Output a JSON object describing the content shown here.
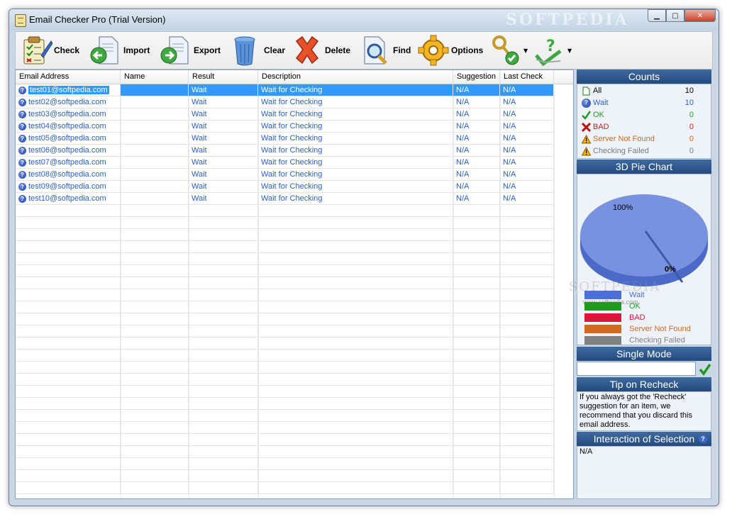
{
  "window": {
    "title": "Email Checker Pro (Trial Version)",
    "watermark": "SOFTPEDIA"
  },
  "toolbar": {
    "items": [
      {
        "label": "Check"
      },
      {
        "label": "Import"
      },
      {
        "label": "Export"
      },
      {
        "label": "Clear"
      },
      {
        "label": "Delete"
      },
      {
        "label": "Find"
      },
      {
        "label": "Options"
      }
    ]
  },
  "grid": {
    "columns": [
      "Email Address",
      "Name",
      "Result",
      "Description",
      "Suggestion",
      "Last Check"
    ],
    "rows": [
      {
        "email": "test01@softpedia.com",
        "name": "",
        "result": "Wait",
        "description": "Wait for Checking",
        "suggestion": "N/A",
        "last_check": "N/A"
      },
      {
        "email": "test02@softpedia.com",
        "name": "",
        "result": "Wait",
        "description": "Wait for Checking",
        "suggestion": "N/A",
        "last_check": "N/A"
      },
      {
        "email": "test03@softpedia.com",
        "name": "",
        "result": "Wait",
        "description": "Wait for Checking",
        "suggestion": "N/A",
        "last_check": "N/A"
      },
      {
        "email": "test04@softpedia.com",
        "name": "",
        "result": "Wait",
        "description": "Wait for Checking",
        "suggestion": "N/A",
        "last_check": "N/A"
      },
      {
        "email": "test05@softpedia.com",
        "name": "",
        "result": "Wait",
        "description": "Wait for Checking",
        "suggestion": "N/A",
        "last_check": "N/A"
      },
      {
        "email": "test06@softpedia.com",
        "name": "",
        "result": "Wait",
        "description": "Wait for Checking",
        "suggestion": "N/A",
        "last_check": "N/A"
      },
      {
        "email": "test07@softpedia.com",
        "name": "",
        "result": "Wait",
        "description": "Wait for Checking",
        "suggestion": "N/A",
        "last_check": "N/A"
      },
      {
        "email": "test08@softpedia.com",
        "name": "",
        "result": "Wait",
        "description": "Wait for Checking",
        "suggestion": "N/A",
        "last_check": "N/A"
      },
      {
        "email": "test09@softpedia.com",
        "name": "",
        "result": "Wait",
        "description": "Wait for Checking",
        "suggestion": "N/A",
        "last_check": "N/A"
      },
      {
        "email": "test10@softpedia.com",
        "name": "",
        "result": "Wait",
        "description": "Wait for Checking",
        "suggestion": "N/A",
        "last_check": "N/A"
      }
    ]
  },
  "counts": {
    "title": "Counts",
    "items": [
      {
        "label": "All",
        "value": "10",
        "color": "#000000"
      },
      {
        "label": "Wait",
        "value": "10",
        "color": "#2a5fc9"
      },
      {
        "label": "OK",
        "value": "0",
        "color": "#1f9a1f"
      },
      {
        "label": "BAD",
        "value": "0",
        "color": "#d01c1c"
      },
      {
        "label": "Server Not Found",
        "value": "0",
        "color": "#d06a1c"
      },
      {
        "label": "Checking Failed",
        "value": "0",
        "color": "#7a7a7a"
      }
    ]
  },
  "pie": {
    "title": "3D Pie Chart",
    "label_big": "100%",
    "label_small": "0%",
    "watermark": "SOFTPEDIA",
    "watermark_url": "www.softpedia.com",
    "legend": [
      {
        "label": "Wait",
        "color": "#4a6fd8",
        "text_color": "#4a6fd8"
      },
      {
        "label": "OK",
        "color": "#1f9a1f",
        "text_color": "#1f9a1f"
      },
      {
        "label": "BAD",
        "color": "#dc143c",
        "text_color": "#dc143c"
      },
      {
        "label": "Server Not Found",
        "color": "#d2691e",
        "text_color": "#d2691e"
      },
      {
        "label": "Checking Failed",
        "color": "#808080",
        "text_color": "#808080"
      }
    ]
  },
  "single_mode": {
    "title": "Single Mode",
    "value": ""
  },
  "tip": {
    "title": "Tip on Recheck",
    "text": "If you always got the 'Recheck' suggestion for an item, we recommend that you discard this email address."
  },
  "interaction": {
    "title": "Interaction of Selection",
    "value": "N/A"
  }
}
